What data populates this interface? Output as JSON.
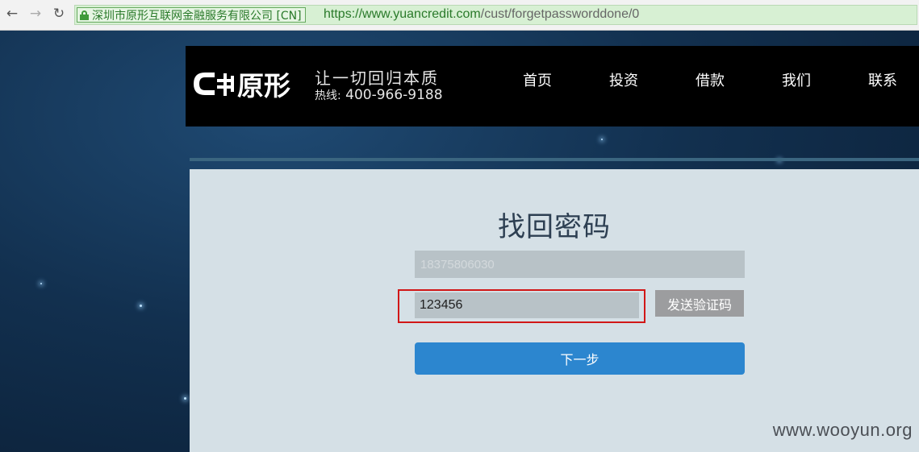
{
  "browser": {
    "back_icon": "←",
    "forward_icon": "→",
    "reload_icon": "↻",
    "certificate": "深圳市原形互联网金融服务有限公司 [CN]",
    "url_base": "https://www.yuancredit.com",
    "url_path": "/cust/forgetpassworddone/0"
  },
  "header": {
    "logo": "原形",
    "slogan": "让一切回归本质",
    "hotline_label": "热线:",
    "hotline_number": "400-966-9188",
    "nav": [
      "首页",
      "投资",
      "借款",
      "我们",
      "联系"
    ]
  },
  "form": {
    "title": "找回密码",
    "phone_value": "18375806030",
    "code_value": "123456",
    "send_code_label": "发送验证码",
    "next_label": "下一步"
  },
  "watermark": "www.wooyun.org",
  "colors": {
    "accent": "#2c86cf",
    "highlight": "#d11717",
    "header_bg": "#000000"
  }
}
